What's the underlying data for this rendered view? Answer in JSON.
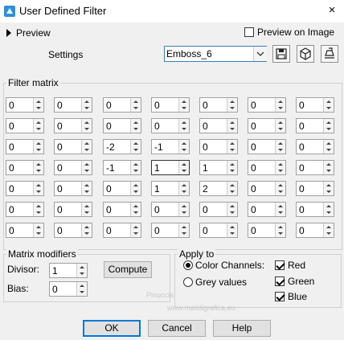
{
  "window": {
    "title": "User Defined Filter",
    "close_glyph": "×",
    "icon": "app-icon"
  },
  "preview": {
    "label": "Preview",
    "preview_on_image_label": "Preview on Image",
    "preview_on_image_checked": false
  },
  "settings": {
    "label": "Settings",
    "selected": "Emboss_6"
  },
  "toolbar": {
    "icons": [
      "save-icon",
      "reset-icon",
      "manage-icon"
    ]
  },
  "matrix": {
    "label": "Filter matrix",
    "rows": [
      [
        "0",
        "0",
        "0",
        "0",
        "0",
        "0",
        "0"
      ],
      [
        "0",
        "0",
        "0",
        "0",
        "0",
        "0",
        "0"
      ],
      [
        "0",
        "0",
        "-2",
        "-1",
        "0",
        "0",
        "0"
      ],
      [
        "0",
        "0",
        "-1",
        "1",
        "1",
        "0",
        "0"
      ],
      [
        "0",
        "0",
        "0",
        "1",
        "2",
        "0",
        "0"
      ],
      [
        "0",
        "0",
        "0",
        "0",
        "0",
        "0",
        "0"
      ],
      [
        "0",
        "0",
        "0",
        "0",
        "0",
        "0",
        "0"
      ]
    ]
  },
  "modifiers": {
    "label": "Matrix modifiers",
    "divisor_label": "Divisor:",
    "divisor": "1",
    "bias_label": "Bias:",
    "bias": "0",
    "compute_label": "Compute"
  },
  "apply_to": {
    "label": "Apply to",
    "color_channels_label": "Color Channels:",
    "grey_values_label": "Grey values",
    "red_label": "Red",
    "green_label": "Green",
    "blue_label": "Blue"
  },
  "buttons": {
    "ok": "OK",
    "cancel": "Cancel",
    "help": "Help"
  },
  "watermark": {
    "name": "Pinuccia",
    "site": "www.maildigrafica.eu"
  },
  "colors": {
    "accent": "#0078d7",
    "combo_border": "#3c7fb1",
    "dialog_bg": "#f0f0f0"
  }
}
